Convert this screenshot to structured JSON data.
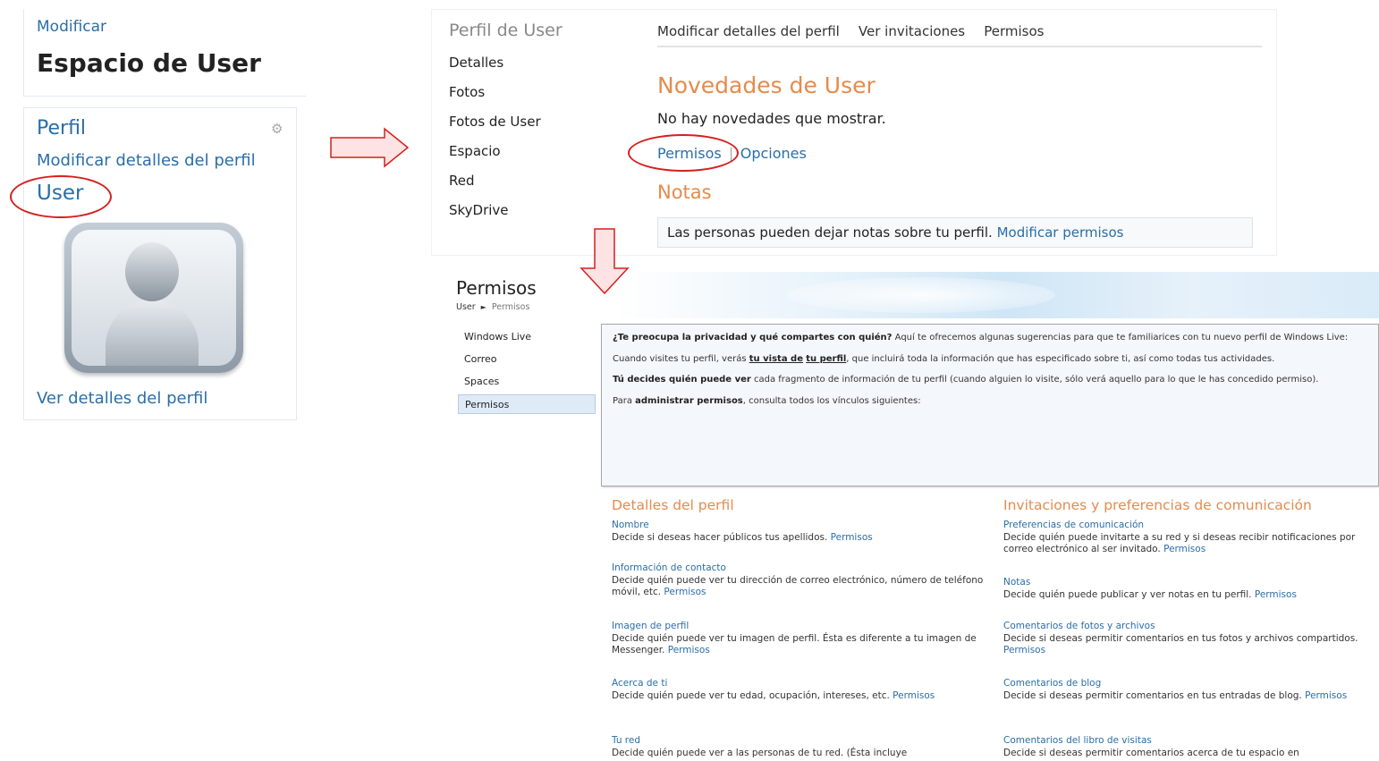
{
  "panel_left": {
    "modify_link": "Modificar",
    "space_title": "Espacio de User",
    "profile_heading": "Perfil",
    "gear_icon": "gear-icon",
    "edit_profile_link": "Modificar detalles del perfil",
    "user_link": "User",
    "view_profile_link": "Ver detalles del perfil"
  },
  "panel_middle": {
    "side_title": "Perfil de User",
    "side_items": [
      "Detalles",
      "Fotos",
      "Fotos de User",
      "Espacio",
      "Red",
      "SkyDrive"
    ],
    "tabs": [
      "Modificar detalles del perfil",
      "Ver invitaciones",
      "Permisos"
    ],
    "news_title": "Novedades de User",
    "no_news": "No hay novedades que mostrar.",
    "permisos_link": "Permisos",
    "opciones_link": "Opciones",
    "notas_title": "Notas",
    "notas_text": "Las personas pueden dejar notas sobre tu perfil.",
    "notas_link": "Modificar permisos"
  },
  "panel_bottom": {
    "title": "Permisos",
    "breadcrumb": {
      "root": "User",
      "current": "Permisos"
    },
    "nav": [
      "Windows Live",
      "Correo",
      "Spaces",
      "Permisos"
    ],
    "info": {
      "p1_bold": "¿Te preocupa la privacidad y qué compartes con quién?",
      "p1_rest": " Aquí te ofrecemos algunas sugerencias para que te familiarices con tu nuevo perfil de Windows Live:",
      "p2_a": "Cuando visites tu perfil, verás ",
      "p2_u1": "tu vista de",
      "p2_b": " ",
      "p2_u2": "tu perfil",
      "p2_c": ", que incluirá toda la información que has especificado sobre ti, así como todas tus actividades.",
      "p3_bold": "Tú decides quién puede ver",
      "p3_rest": " cada fragmento de información de tu perfil (cuando alguien lo visite, sólo verá aquello para lo que le has concedido permiso).",
      "p4_a": "Para ",
      "p4_bold": "administrar permisos",
      "p4_rest": ", consulta todos los vínculos siguientes:"
    },
    "left_section": {
      "title": "Detalles del perfil",
      "entries": [
        {
          "title": "Nombre",
          "text": "Decide si deseas hacer públicos tus apellidos.",
          "link": "Permisos"
        },
        {
          "title": "Información de contacto",
          "text": "Decide quién puede ver tu dirección de correo electrónico, número de teléfono móvil, etc.",
          "link": "Permisos"
        },
        {
          "title": "Imagen de perfil",
          "text": "Decide quién puede ver tu imagen de perfil. Ésta es diferente a tu imagen de Messenger.",
          "link": "Permisos"
        },
        {
          "title": "Acerca de ti",
          "text": "Decide quién puede ver tu edad, ocupación, intereses, etc.",
          "link": "Permisos"
        },
        {
          "title": "Tu red",
          "text": "Decide quién puede ver a las personas de tu red. (Ésta incluye",
          "link": ""
        }
      ]
    },
    "right_section": {
      "title": "Invitaciones y preferencias de comunicación",
      "entries": [
        {
          "title": "Preferencias de comunicación",
          "text": "Decide quién puede invitarte a su red y si deseas recibir notificaciones por correo electrónico al ser invitado.",
          "link": "Permisos"
        },
        {
          "title": "Notas",
          "text": "Decide quién puede publicar y ver notas en tu perfil.",
          "link": "Permisos"
        },
        {
          "title": "Comentarios de fotos y archivos",
          "text": "Decide si deseas permitir comentarios en tus fotos y archivos compartidos.",
          "link": "Permisos"
        },
        {
          "title": "Comentarios de blog",
          "text": "Decide si deseas permitir comentarios en tus entradas de blog.",
          "link": "Permisos"
        },
        {
          "title": "Comentarios del libro de visitas",
          "text": "Decide si deseas permitir comentarios acerca de tu espacio en",
          "link": ""
        }
      ]
    }
  },
  "colors": {
    "link": "#2a6ea8",
    "heading_orange": "#e58b4c",
    "highlight_red": "#d61f1f",
    "arrow_fill": "#fde3e3"
  }
}
